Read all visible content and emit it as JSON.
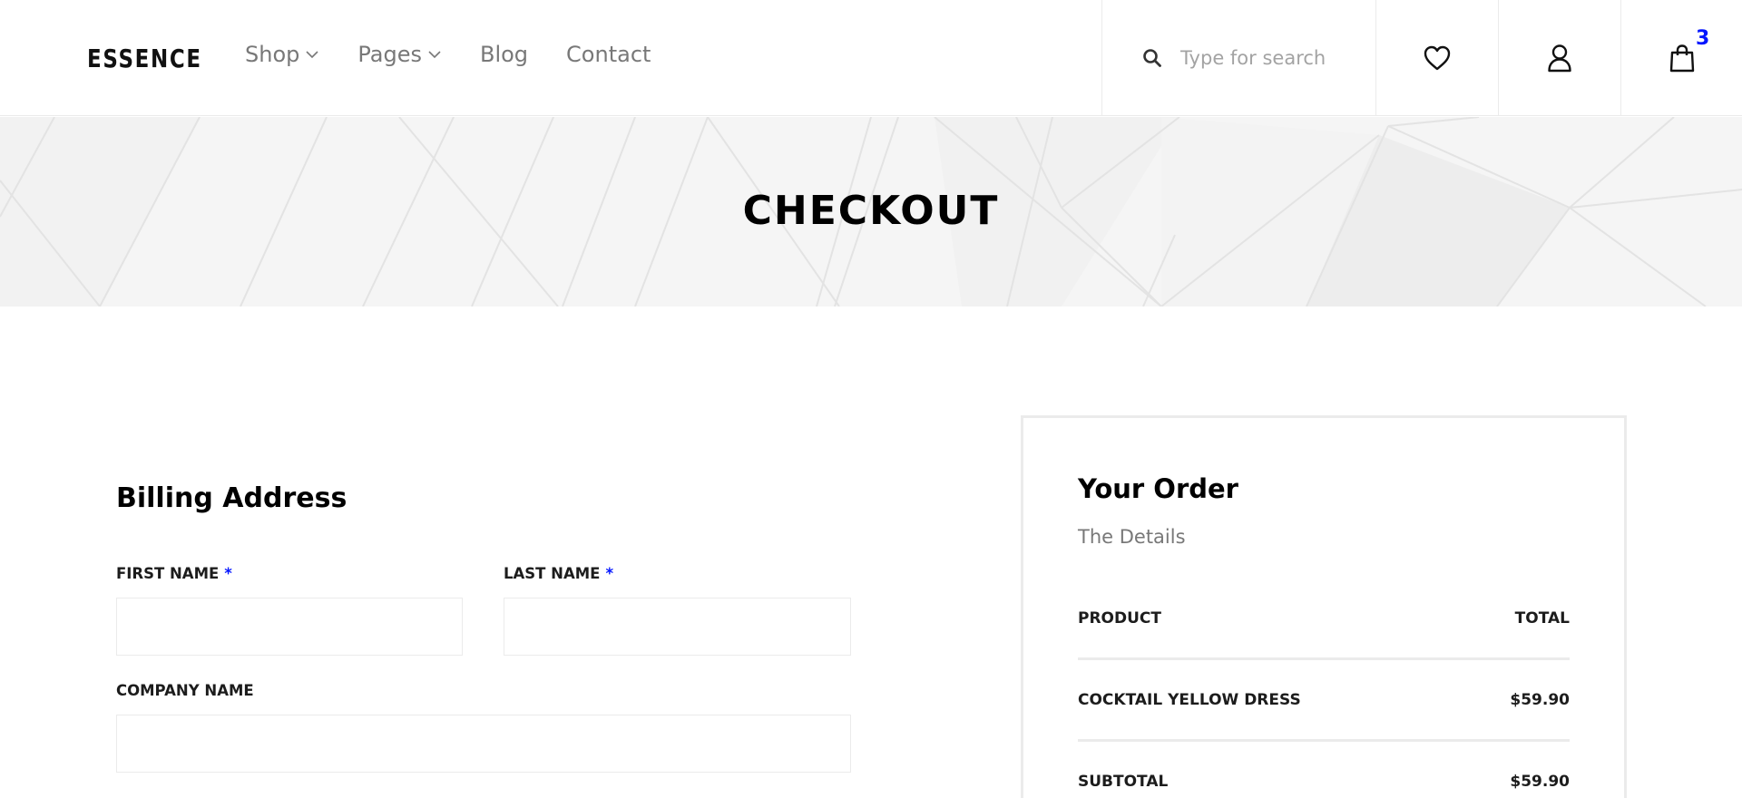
{
  "brand": {
    "logo_text": "ESSENCE"
  },
  "nav": {
    "items": [
      {
        "label": "Shop",
        "has_dropdown": true
      },
      {
        "label": "Pages",
        "has_dropdown": true
      },
      {
        "label": "Blog",
        "has_dropdown": false
      },
      {
        "label": "Contact",
        "has_dropdown": false
      }
    ]
  },
  "search": {
    "placeholder": "Type for search",
    "icon": "search-icon"
  },
  "header_actions": {
    "wishlist_icon": "heart-icon",
    "user_icon": "user-icon",
    "cart_icon": "shopping-bag-icon",
    "cart_count": "3"
  },
  "banner": {
    "title": "CHECKOUT"
  },
  "billing": {
    "title": "Billing Address",
    "required_marker": "*",
    "fields": {
      "first_name": {
        "label": "FIRST NAME",
        "required": true,
        "value": ""
      },
      "last_name": {
        "label": "LAST NAME",
        "required": true,
        "value": ""
      },
      "company_name": {
        "label": "COMPANY NAME",
        "required": false,
        "value": ""
      }
    }
  },
  "order": {
    "title": "Your Order",
    "subtitle": "The Details",
    "header": {
      "product": "PRODUCT",
      "total": "TOTAL"
    },
    "items": [
      {
        "name": "COCKTAIL YELLOW DRESS",
        "price": "$59.90"
      }
    ],
    "subtotal": {
      "label": "SUBTOTAL",
      "value": "$59.90"
    }
  },
  "colors": {
    "accent": "#0315ff",
    "nav_text": "#787878",
    "border": "#ebebeb",
    "banner_bg": "#f5f5f5"
  }
}
